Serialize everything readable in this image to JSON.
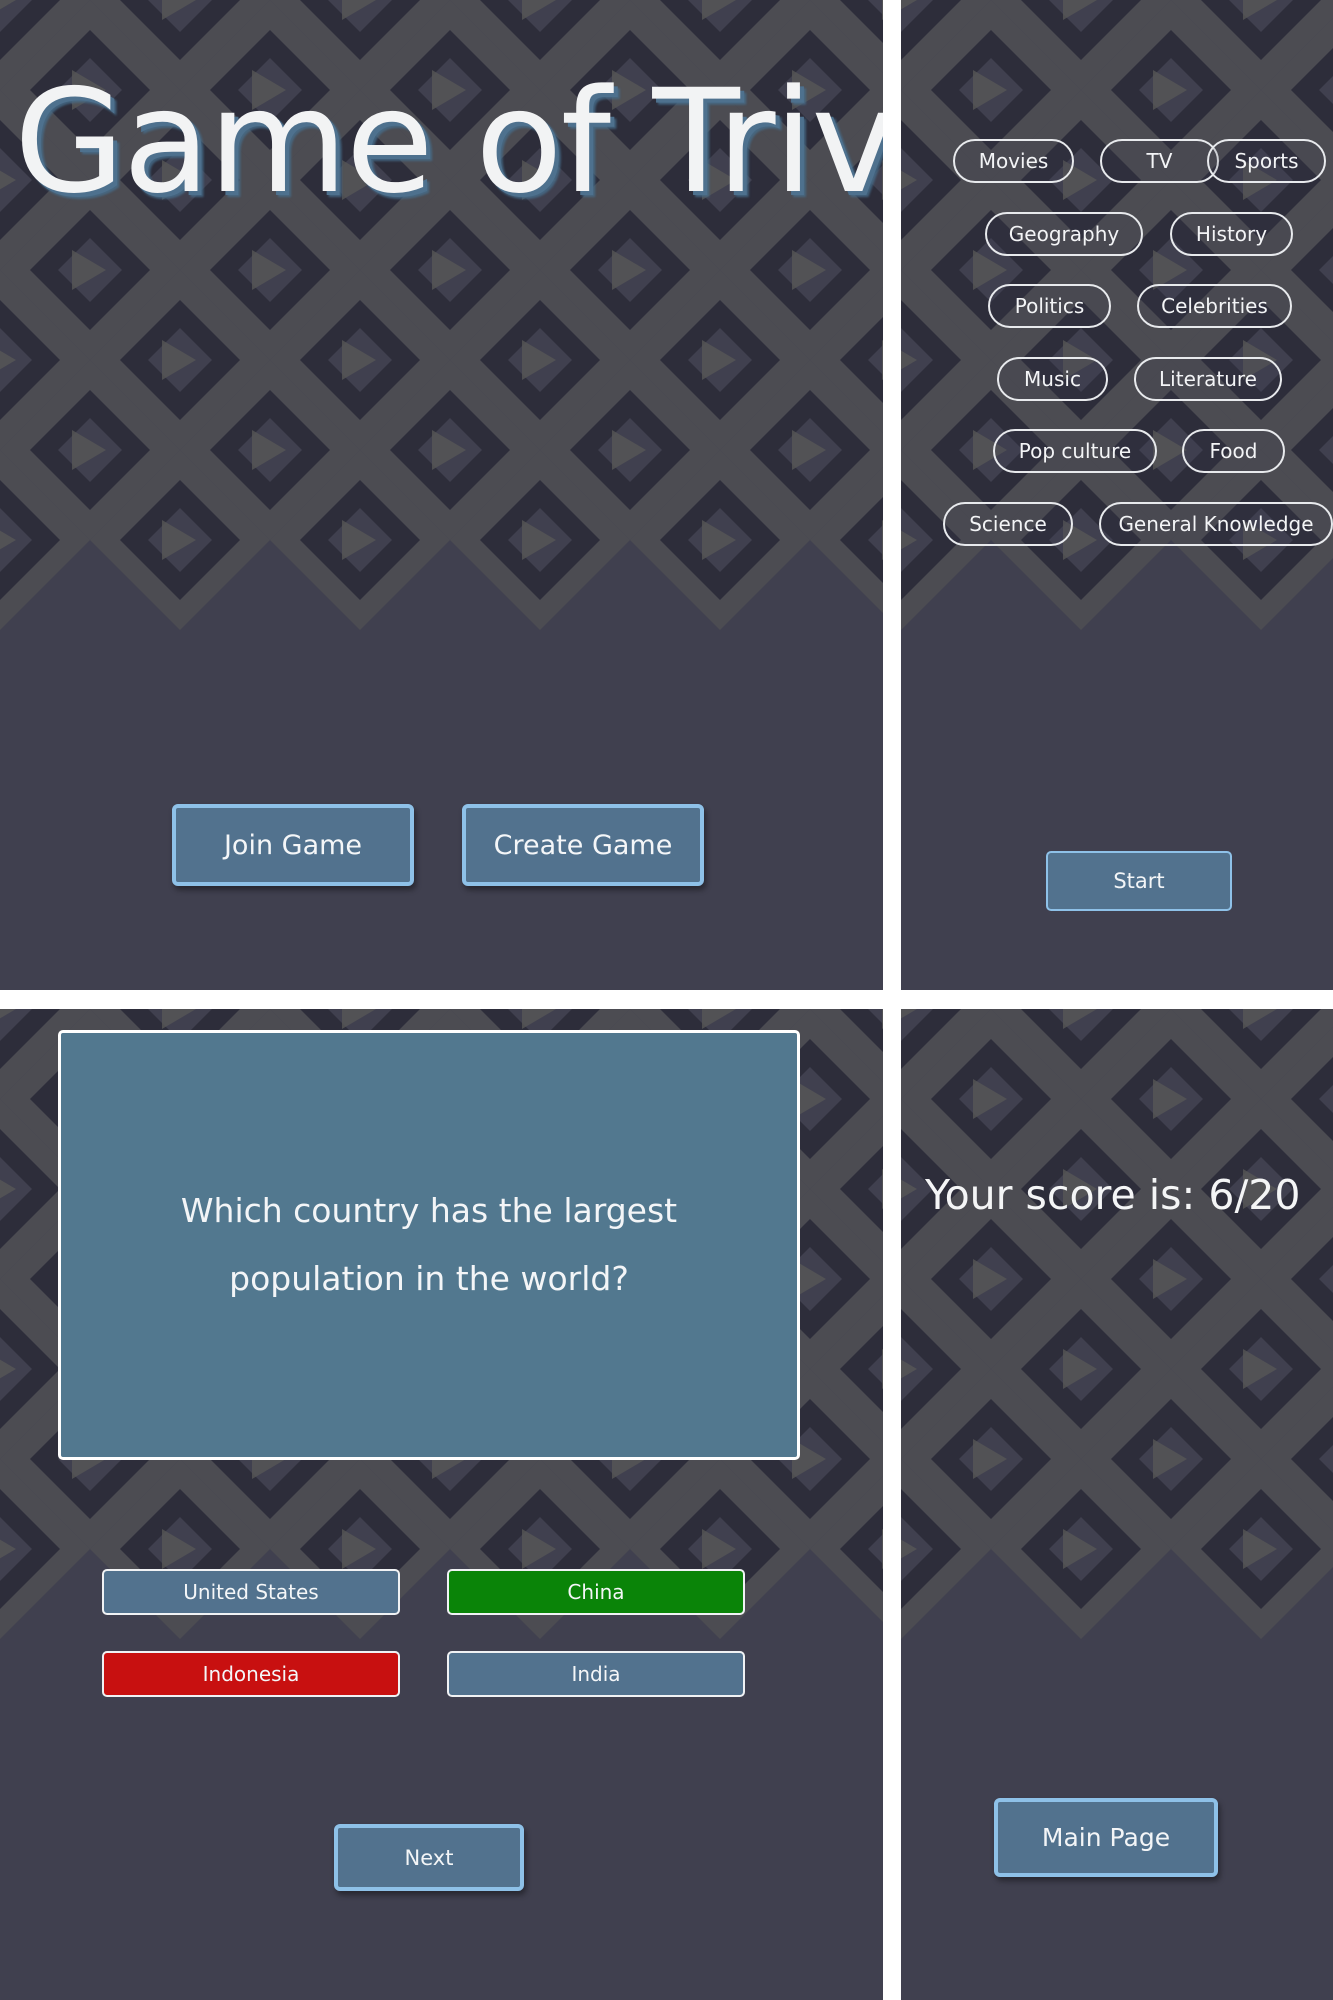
{
  "colors": {
    "bg_dark": "#2d2d3a",
    "bg_mid": "#40404f",
    "bg_light": "#565656",
    "button": "#52728e",
    "button_border": "#8ec1e8",
    "correct": "#0a8408",
    "wrong": "#c81010"
  },
  "home": {
    "title": "Game of Trivia",
    "join_label": "Join Game",
    "create_label": "Create Game"
  },
  "categories": {
    "items": [
      "Movies",
      "TV",
      "Sports",
      "Geography",
      "History",
      "Politics",
      "Celebrities",
      "Music",
      "Literature",
      "Pop culture",
      "Food",
      "Science",
      "General Knowledge"
    ],
    "start_label": "Start"
  },
  "question": {
    "text": "Which country has the largest population in the world?",
    "answers": [
      {
        "label": "United States",
        "state": "neutral"
      },
      {
        "label": "China",
        "state": "correct"
      },
      {
        "label": "Indonesia",
        "state": "wrong"
      },
      {
        "label": "India",
        "state": "neutral"
      }
    ],
    "next_label": "Next"
  },
  "result": {
    "score_text": "Your score is: 6/20",
    "main_page_label": "Main Page"
  }
}
